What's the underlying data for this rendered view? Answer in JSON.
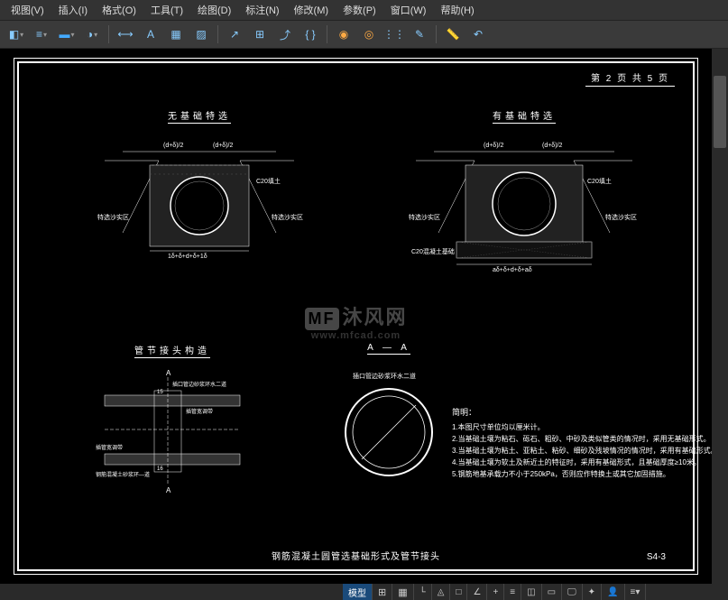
{
  "menu": {
    "items": [
      "视图(V)",
      "插入(I)",
      "格式(O)",
      "工具(T)",
      "绘图(D)",
      "标注(N)",
      "修改(M)",
      "参数(P)",
      "窗口(W)",
      "帮助(H)"
    ]
  },
  "toolbar_icons": [
    "layer",
    "linetype",
    "lineweight",
    "color",
    "dim",
    "text",
    "block",
    "hatch",
    "leader",
    "table",
    "mleader",
    "field",
    "group",
    "align",
    "array",
    "modify",
    "measure",
    "undo"
  ],
  "page_info": {
    "text": "第 2 页  共 5 页"
  },
  "details": {
    "d1": {
      "title": "无基础特选",
      "dim1": "(d+δ)/2",
      "dim2": "(d+δ)/2",
      "label_c": "C20填土",
      "label_l": "特选沙实区",
      "label_r": "特选沙实区",
      "bottom": "1δ+δ+d+δ+1δ"
    },
    "d2": {
      "title": "有基础特选",
      "dim1": "(d+δ)/2",
      "dim2": "(d+δ)/2",
      "label_c": "C20填土",
      "label_l": "特选沙实区",
      "label_r": "特选沙实区",
      "label_b": "C20混凝土基础",
      "bottom": "aδ+δ+d+δ+aδ"
    },
    "d3": {
      "title": "管节接头构造",
      "a": "A",
      "top_label": "插口管边砂浆环水二道",
      "mid_label": "插管宽调带",
      "bot_label": "插管宽调带",
      "bot2_label": "钢筋混凝土砂浆环—道",
      "d15": "15",
      "d16": "16"
    },
    "d4": {
      "title": "A — A",
      "ring_label": "插口管边砂浆环水二道"
    }
  },
  "notes": {
    "title": "简明：",
    "lines": [
      "1.本图尺寸单位均以厘米计。",
      "2.当基础土壤为粘石、砾石、粗砂、中砂及类似管类的情况时，采用无基础形式。",
      "3.当基础土壤为粘土、亚粘土、粘砂、细砂及残坡情况的情况时，采用有基础形式。",
      "4.当基础土壤为软土及新近土的特征时，采用有基础形式，且基础厚度≥10米。",
      "5.钢筋地基承载力不小于250kPa，否则应作特换土或其它加固措施。"
    ]
  },
  "sheet": {
    "title": "钢筋混凝土圆管选基础形式及管节接头",
    "num": "S4-3"
  },
  "watermark": {
    "main": "沐风网",
    "sub": "www.mfcad.com",
    "logo": "MF"
  },
  "status": {
    "model": "模型"
  }
}
